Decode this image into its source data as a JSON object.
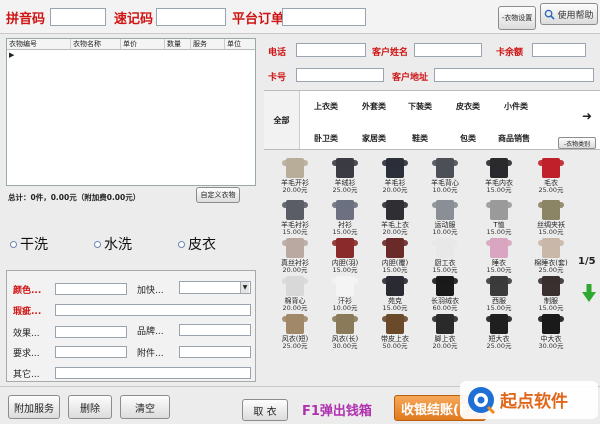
{
  "top": {
    "pinyin_label": "拼音码",
    "quick_label": "速记码",
    "platform_label": "平台订单",
    "settings_button": "-衣物设置",
    "help_button": "使用帮助"
  },
  "order_table": {
    "columns": [
      "衣物编号",
      "衣物名称",
      "单价",
      "数量",
      "服务",
      "单位"
    ]
  },
  "summary": {
    "total_text": "总计：0件，0.00元（附加费0.00元）",
    "custom_button": "自定义衣物"
  },
  "wash_options": [
    "干洗",
    "水洗",
    "皮衣"
  ],
  "form": {
    "color_label": "颜色...",
    "urgent_label": "加快...",
    "flaw_label": "瑕疵...",
    "effect_label": "效果...",
    "brand_label": "品牌...",
    "request_label": "要求...",
    "accessory_label": "附件...",
    "other_label": "其它..."
  },
  "customer": {
    "phone_label": "电话",
    "name_label": "客户姓名",
    "balance_label": "卡余额",
    "card_label": "卡号",
    "address_label": "客户地址"
  },
  "categories": {
    "all": "全部",
    "row1": [
      "上衣类",
      "外套类",
      "下装类",
      "皮衣类",
      "小件类"
    ],
    "row2": [
      "卧卫类",
      "家居类",
      "鞋类",
      "包类",
      "商品销售"
    ],
    "switch_button": "-衣物类别"
  },
  "items": [
    {
      "name": "羊毛开衫",
      "price": "20.00元",
      "color": "#b8ad98"
    },
    {
      "name": "羊绒衫",
      "price": "25.00元",
      "color": "#3b3b44"
    },
    {
      "name": "羊毛衫",
      "price": "20.00元",
      "color": "#2b2f3a"
    },
    {
      "name": "羊毛背心",
      "price": "10.00元",
      "color": "#4d4f57"
    },
    {
      "name": "羊毛内衣",
      "price": "15.00元",
      "color": "#2a2a2e"
    },
    {
      "name": "毛衣",
      "price": "25.00元",
      "color": "#c0202a"
    },
    {
      "name": "羊毛衬衫",
      "price": "15.00元",
      "color": "#5a5d66"
    },
    {
      "name": "衬衫",
      "price": "15.00元",
      "color": "#6c7080"
    },
    {
      "name": "羊毛上衣",
      "price": "20.00元",
      "color": "#2f2f33"
    },
    {
      "name": "运动服",
      "price": "10.00元",
      "color": "#8a8f96"
    },
    {
      "name": "T恤",
      "price": "15.00元",
      "color": "#9a9a9a"
    },
    {
      "name": "丝绸夹袄",
      "price": "15.00元",
      "color": "#8b8465"
    },
    {
      "name": "真丝衬衫",
      "price": "20.00元",
      "color": "#b9a9a0"
    },
    {
      "name": "内胆(羽)",
      "price": "15.00元",
      "color": "#8a2a2a"
    },
    {
      "name": "内胆(覆)",
      "price": "15.00元",
      "color": "#6a2a2a"
    },
    {
      "name": "厨工衣",
      "price": "15.00元",
      "color": "#e8e8e8"
    },
    {
      "name": "睡衣",
      "price": "15.00元",
      "color": "#d9a5c0"
    },
    {
      "name": "棉睡衣(套)",
      "price": "25.00元",
      "color": "#c9b8a8"
    },
    {
      "name": "棉背心",
      "price": "20.00元",
      "color": "#d8d8d8"
    },
    {
      "name": "汗衫",
      "price": "10.00元",
      "color": "#f4f4f4"
    },
    {
      "name": "苑克",
      "price": "15.00元",
      "color": "#2a2a33"
    },
    {
      "name": "长羽绒衣",
      "price": "60.00元",
      "color": "#1a1a1a"
    },
    {
      "name": "西服",
      "price": "15.00元",
      "color": "#3b3b3b"
    },
    {
      "name": "制服",
      "price": "15.00元",
      "color": "#3a3030"
    },
    {
      "name": "风衣(短)",
      "price": "25.00元",
      "color": "#a08868"
    },
    {
      "name": "风衣(长)",
      "price": "30.00元",
      "color": "#8a7a5a"
    },
    {
      "name": "带皮上衣",
      "price": "50.00元",
      "color": "#6a4a2a"
    },
    {
      "name": "脚上衣",
      "price": "20.00元",
      "color": "#2a2a2a"
    },
    {
      "name": "短大衣",
      "price": "25.00元",
      "color": "#1f1f1f"
    },
    {
      "name": "中大衣",
      "price": "30.00元",
      "color": "#1a1a1a"
    }
  ],
  "paging": {
    "page_text": "1/5"
  },
  "bottom": {
    "addon_button": "附加服务",
    "delete_button": "删除",
    "clear_button": "清空",
    "pickup_button": "取 衣",
    "cashbox_text": "F1弹出钱箱",
    "checkout_button": "收银结账(F5)",
    "watermark": "起点软件"
  }
}
